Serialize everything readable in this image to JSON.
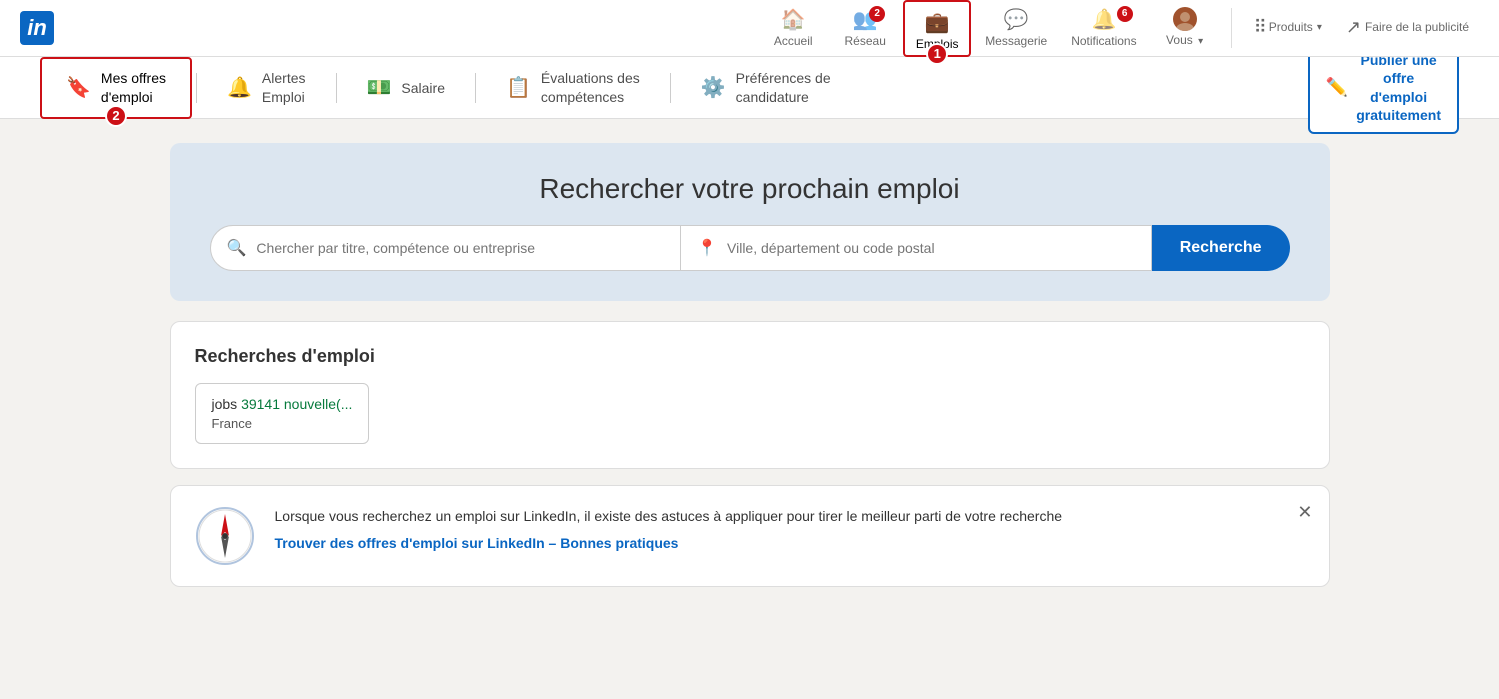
{
  "brand": {
    "logo_letter": "in",
    "logo_aria": "LinkedIn"
  },
  "navbar": {
    "items": [
      {
        "id": "accueil",
        "label": "Accueil",
        "icon": "🏠",
        "badge": null,
        "active": false
      },
      {
        "id": "reseau",
        "label": "Réseau",
        "icon": "👥",
        "badge": "2",
        "active": false
      },
      {
        "id": "emplois",
        "label": "Emplois",
        "icon": "💼",
        "badge": null,
        "active": true,
        "step": "1"
      },
      {
        "id": "messagerie",
        "label": "Messagerie",
        "icon": "💬",
        "badge": null,
        "active": false
      },
      {
        "id": "notifications",
        "label": "Notifications",
        "icon": "🔔",
        "badge": "6",
        "active": false
      },
      {
        "id": "vous",
        "label": "Vous",
        "icon": "avatar",
        "badge": null,
        "active": false,
        "has_chevron": true
      }
    ],
    "products_label": "Produits",
    "ads_label": "Faire de la publicité"
  },
  "sub_nav": {
    "items": [
      {
        "id": "mes-offres",
        "label": "Mes offres\nd'emploi",
        "icon": "🔖",
        "active": true,
        "step": "2"
      },
      {
        "id": "alertes",
        "label": "Alertes\nEmploi",
        "icon": "🔔",
        "active": false
      },
      {
        "id": "salaire",
        "label": "Salaire",
        "icon": "💵",
        "active": false
      },
      {
        "id": "evaluations",
        "label": "Évaluations des\ncompétences",
        "icon": "📋",
        "active": false
      },
      {
        "id": "preferences",
        "label": "Préférences de\ncandidature",
        "icon": "⚙️",
        "active": false
      }
    ],
    "publish_btn": {
      "icon": "✏️",
      "line1": "Publier une",
      "line2": "offre",
      "line3": "d'emploi",
      "line4": "gratuitement"
    }
  },
  "search": {
    "title": "Rechercher votre prochain emploi",
    "job_placeholder": "Chercher par titre, compétence ou entreprise",
    "location_placeholder": "Ville, département ou code postal",
    "button_label": "Recherche"
  },
  "job_searches": {
    "title": "Recherches d'emploi",
    "items": [
      {
        "name": "jobs",
        "count_text": "39141 nouvelle(...",
        "location": "France"
      }
    ]
  },
  "tip": {
    "text": "Lorsque vous recherchez un emploi sur LinkedIn, il existe des astuces à appliquer pour tirer le meilleur parti de votre recherche",
    "link_label": "Trouver des offres d'emploi sur LinkedIn – Bonnes pratiques"
  }
}
